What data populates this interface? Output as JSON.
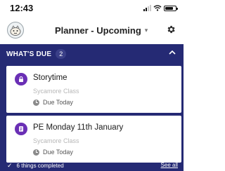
{
  "status_bar": {
    "time": "12:43",
    "icons": [
      "signal-icon",
      "wifi-icon",
      "battery-icon"
    ]
  },
  "header": {
    "avatar_icon": "cookie-avatar-icon",
    "title": "Planner - Upcoming",
    "title_caret": "▾",
    "settings_icon": "gear-icon"
  },
  "due_section": {
    "label": "WHAT'S DUE",
    "count": "2",
    "collapse_icon": "chevron-up-icon",
    "background_color": "#252a74",
    "items": [
      {
        "title": "Storytime",
        "class_name": "Sycamore Class",
        "due": "Due Today",
        "icon": "lock-icon",
        "icon_color": "#6a2fb5"
      },
      {
        "title": "PE Monday 11th January",
        "class_name": "Sycamore Class",
        "due": "Due Today",
        "icon": "document-icon",
        "icon_color": "#6a2fb5"
      }
    ],
    "completed_text": "6 things completed",
    "see_all": "See all"
  }
}
